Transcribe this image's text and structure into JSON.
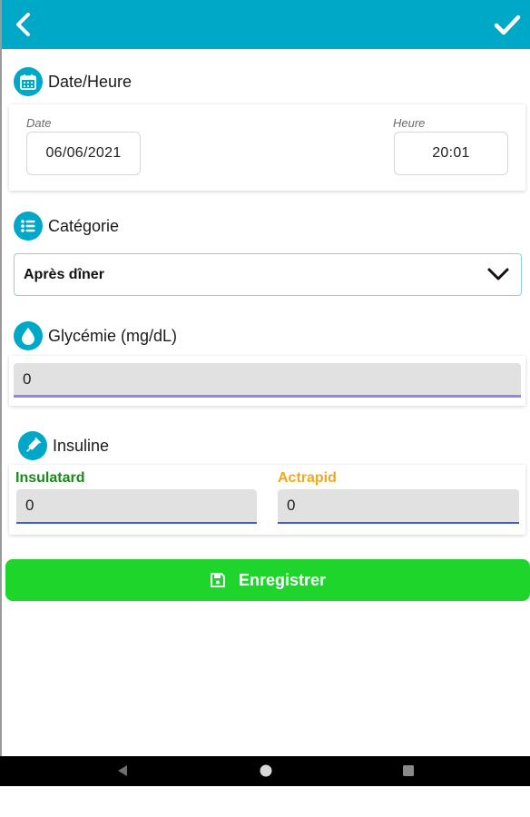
{
  "sections": {
    "datetime": {
      "title": "Date/Heure",
      "date_label": "Date",
      "date_value": "06/06/2021",
      "time_label": "Heure",
      "time_value": "20:01"
    },
    "category": {
      "title": "Catégorie",
      "selected": "Après dîner"
    },
    "glycemia": {
      "title": "Glycémie (mg/dL)",
      "value": "0"
    },
    "insulin": {
      "title": "Insuline",
      "insulatard_label": "Insulatard",
      "insulatard_value": "0",
      "actrapid_label": "Actrapid",
      "actrapid_value": "0"
    }
  },
  "save_label": "Enregistrer",
  "colors": {
    "header": "#00a8c8",
    "save": "#1ed52c",
    "insulatard": "#1a8a1a",
    "actrapid": "#f0a81e"
  },
  "icons": [
    "back-arrow-icon",
    "check-icon",
    "calendar-icon",
    "list-icon",
    "drop-icon",
    "syringe-icon",
    "chevron-down-icon",
    "save-icon",
    "nav-back-icon",
    "nav-home-icon",
    "nav-recents-icon"
  ]
}
